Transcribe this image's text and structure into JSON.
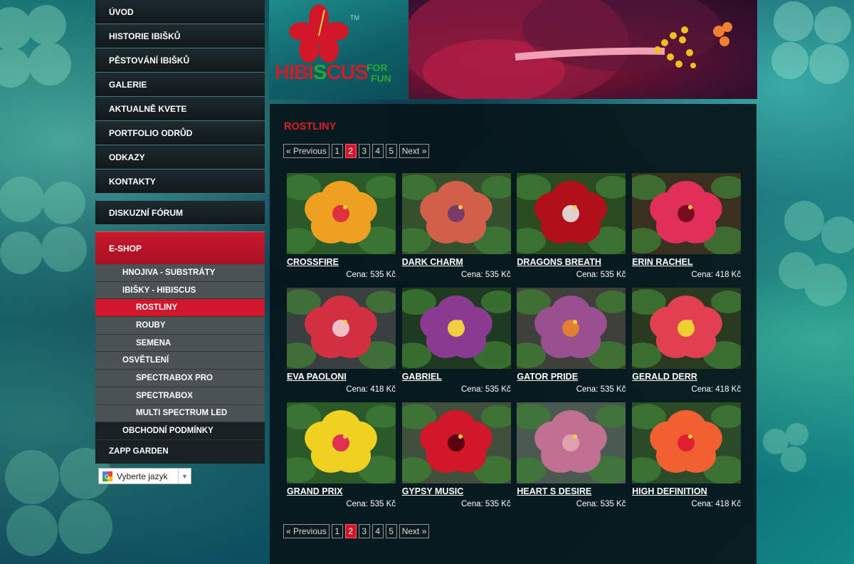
{
  "nav": {
    "items": [
      "ÚVOD",
      "HISTORIE IBIŠKŮ",
      "PĚSTOVÁNÍ IBIŠKŮ",
      "GALERIE",
      "AKTUALNĚ KVETE",
      "PORTFOLIO ODRŮD",
      "ODKAZY",
      "KONTAKTY"
    ],
    "forum": "DISKUZNÍ FÓRUM",
    "eshop": "E-SHOP",
    "sub": [
      {
        "label": "HNOJIVA - SUBSTRÁTY",
        "level": 1
      },
      {
        "label": "IBIŠKY - HIBISCUS",
        "level": 1
      },
      {
        "label": "ROSTLINY",
        "level": 2,
        "active": true
      },
      {
        "label": "ROUBY",
        "level": 2
      },
      {
        "label": "SEMENA",
        "level": 2
      },
      {
        "label": "OSVĚTLENÍ",
        "level": 1
      },
      {
        "label": "SPECTRABOX PRO",
        "level": 2
      },
      {
        "label": "SPECTRABOX",
        "level": 2
      },
      {
        "label": "MULTI SPECTRUM LED",
        "level": 2
      },
      {
        "label": "OBCHODNÍ PODMÍNKY",
        "level": 1,
        "dark": true
      }
    ],
    "zapp": "ZAPP GARDEN"
  },
  "language": {
    "label": "Vyberte jazyk"
  },
  "logo": {
    "main_a": "HIBI",
    "main_s": "S",
    "main_b": "CUS",
    "for": "FOR",
    "fun": "FUN",
    "tm": "TM"
  },
  "page": {
    "title": "ROSTLINY"
  },
  "pager": {
    "previous": "« Previous",
    "pages": [
      "1",
      "2",
      "3",
      "4",
      "5"
    ],
    "current": "2",
    "next": "Next »"
  },
  "products": [
    {
      "name": "CROSSFIRE",
      "price": "Cena: 535 Kč",
      "petal": "#f0a020",
      "center": "#e03040",
      "bg": "#2a5a28"
    },
    {
      "name": "DARK CHARM",
      "price": "Cena: 535 Kč",
      "petal": "#d0604a",
      "center": "#7a3a6a",
      "bg": "#34502c"
    },
    {
      "name": "DRAGONS BREATH",
      "price": "Cena: 535 Kč",
      "petal": "#b0101a",
      "center": "#e0d0d0",
      "bg": "#2a4a20"
    },
    {
      "name": "ERIN RACHEL",
      "price": "Cena: 418 Kč",
      "petal": "#e0305a",
      "center": "#7a0a20",
      "bg": "#3a3020"
    },
    {
      "name": "EVA PAOLONI",
      "price": "Cena: 418 Kč",
      "petal": "#d03040",
      "center": "#f0c0c8",
      "bg": "#3a4040"
    },
    {
      "name": "GABRIEL",
      "price": "Cena: 535 Kč",
      "petal": "#8a3a90",
      "center": "#f0d040",
      "bg": "#1e3a20"
    },
    {
      "name": "GATOR PRIDE",
      "price": "Cena: 535 Kč",
      "petal": "#9a5090",
      "center": "#e08030",
      "bg": "#40403a"
    },
    {
      "name": "GERALD DERR",
      "price": "Cena: 418 Kč",
      "petal": "#e04050",
      "center": "#f0d030",
      "bg": "#2a3a20"
    },
    {
      "name": "GRAND PRIX",
      "price": "Cena: 535 Kč",
      "petal": "#f0d020",
      "center": "#e03050",
      "bg": "#2a5a28"
    },
    {
      "name": "GYPSY MUSIC",
      "price": "Cena: 535 Kč",
      "petal": "#d01828",
      "center": "#5a0010",
      "bg": "#40503a"
    },
    {
      "name": "HEART S DESIRE",
      "price": "Cena: 535 Kč",
      "petal": "#c07090",
      "center": "#e0a0b0",
      "bg": "#4a5a50"
    },
    {
      "name": "HIGH DEFINITION",
      "price": "Cena: 418 Kč",
      "petal": "#f06030",
      "center": "#e02030",
      "bg": "#2a4a28"
    }
  ]
}
